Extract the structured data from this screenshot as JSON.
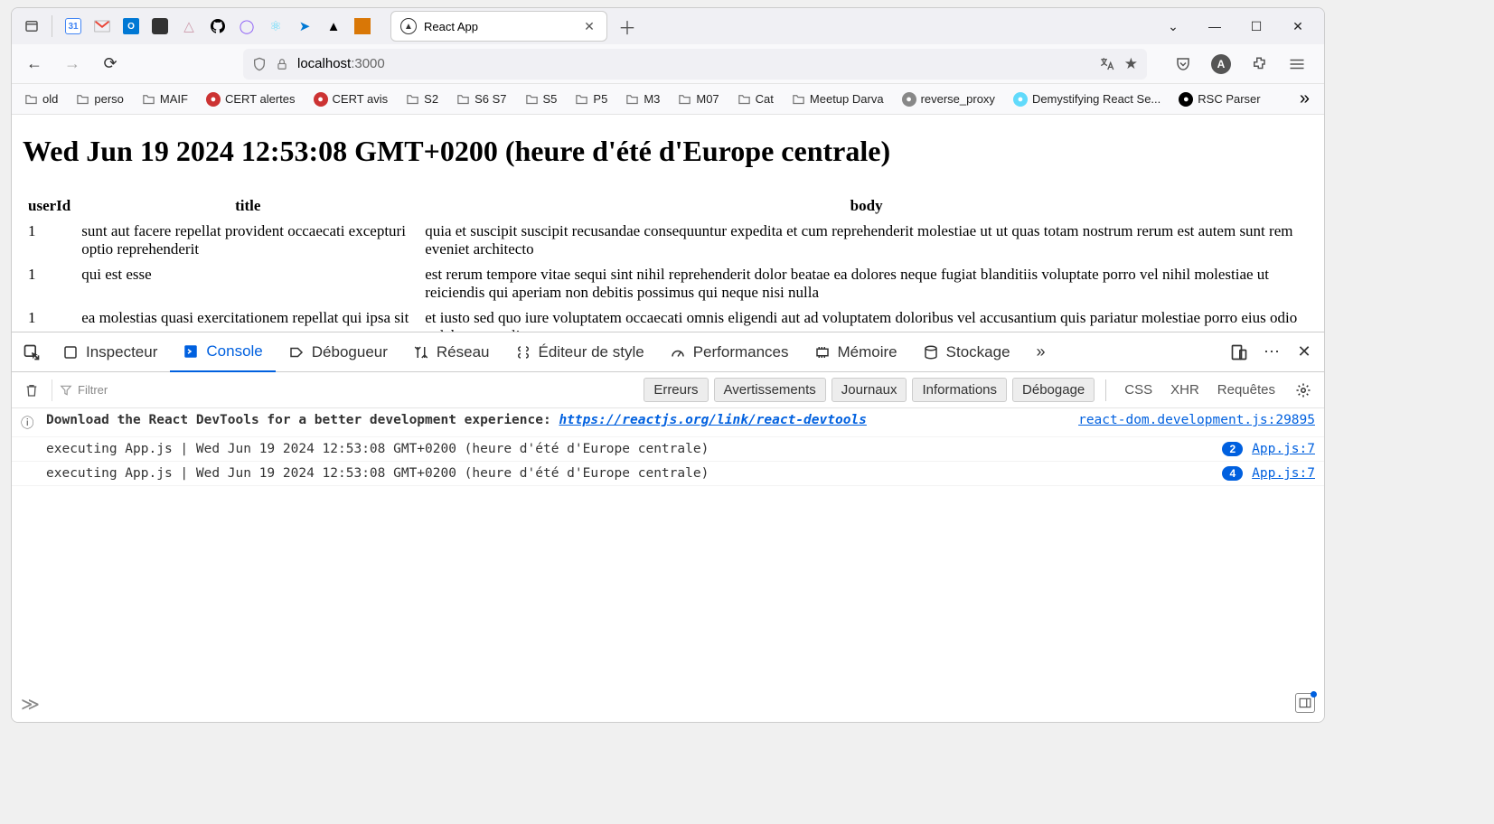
{
  "tab": {
    "title": "React App"
  },
  "url": {
    "host": "localhost",
    "port": ":3000"
  },
  "bookmarks": [
    {
      "label": "old",
      "type": "folder"
    },
    {
      "label": "perso",
      "type": "folder"
    },
    {
      "label": "MAIF",
      "type": "folder"
    },
    {
      "label": "CERT alertes",
      "type": "fav",
      "color": "#c33"
    },
    {
      "label": "CERT avis",
      "type": "fav",
      "color": "#c33"
    },
    {
      "label": "S2",
      "type": "folder"
    },
    {
      "label": "S6 S7",
      "type": "folder"
    },
    {
      "label": "S5",
      "type": "folder"
    },
    {
      "label": "P5",
      "type": "folder"
    },
    {
      "label": "M3",
      "type": "folder"
    },
    {
      "label": "M07",
      "type": "folder"
    },
    {
      "label": "Cat",
      "type": "folder"
    },
    {
      "label": "Meetup Darva",
      "type": "folder"
    },
    {
      "label": "reverse_proxy",
      "type": "fav",
      "color": "#888"
    },
    {
      "label": "Demystifying React Se...",
      "type": "fav",
      "color": "#61dafb"
    },
    {
      "label": "RSC Parser",
      "type": "fav",
      "color": "#000"
    }
  ],
  "page": {
    "heading": "Wed Jun 19 2024 12:53:08 GMT+0200 (heure d'été d'Europe centrale)",
    "columns": [
      "userId",
      "title",
      "body"
    ],
    "rows": [
      {
        "userId": "1",
        "title": "sunt aut facere repellat provident occaecati excepturi optio reprehenderit",
        "body": "quia et suscipit suscipit recusandae consequuntur expedita et cum reprehenderit molestiae ut ut quas totam nostrum rerum est autem sunt rem eveniet architecto"
      },
      {
        "userId": "1",
        "title": "qui est esse",
        "body": "est rerum tempore vitae sequi sint nihil reprehenderit dolor beatae ea dolores neque fugiat blanditiis voluptate porro vel nihil molestiae ut reiciendis qui aperiam non debitis possimus qui neque nisi nulla"
      },
      {
        "userId": "1",
        "title": "ea molestias quasi exercitationem repellat qui ipsa sit aut",
        "body": "et iusto sed quo iure voluptatem occaecati omnis eligendi aut ad voluptatem doloribus vel accusantium quis pariatur molestiae porro eius odio et labore et velit aut"
      }
    ]
  },
  "devtools": {
    "tabs": [
      "Inspecteur",
      "Console",
      "Débogueur",
      "Réseau",
      "Éditeur de style",
      "Performances",
      "Mémoire",
      "Stockage"
    ],
    "active_tab": "Console",
    "filter_placeholder": "Filtrer",
    "chips": [
      "Erreurs",
      "Avertissements",
      "Journaux",
      "Informations",
      "Débogage"
    ],
    "link_chips": [
      "CSS",
      "XHR",
      "Requêtes"
    ],
    "lines": [
      {
        "icon": "info",
        "text": "Download the React DevTools for a better development experience: ",
        "link": "https://reactjs.org/link/react-devtools",
        "source": "react-dom.development.js:29895"
      },
      {
        "text": "executing App.js | Wed Jun 19 2024 12:53:08 GMT+0200 (heure d'été d'Europe centrale)",
        "count": "2",
        "source": "App.js:7"
      },
      {
        "text": "executing App.js | Wed Jun 19 2024 12:53:08 GMT+0200 (heure d'été d'Europe centrale)",
        "count": "4",
        "source": "App.js:7"
      }
    ]
  },
  "account_initial": "A"
}
